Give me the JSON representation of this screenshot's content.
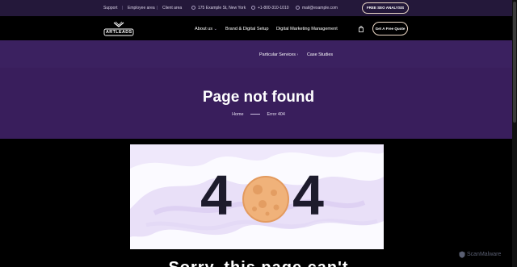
{
  "topbar": {
    "support": "Support",
    "employee": "Employee area",
    "client": "Client area",
    "address": "175 Example St, New York",
    "phone": "+1-800-310-1010",
    "email": "mail@example.com",
    "seo_button": "FREE SEO ANALYSIS"
  },
  "nav": {
    "logo_text": "ARTLEADS",
    "about": "About us",
    "brand": "Brand & Digital Setup",
    "marketing": "Digital Marketing Management",
    "quote_button": "Get A Free Quote"
  },
  "subnav": {
    "services": "Particular Services",
    "cases": "Case Studies"
  },
  "hero": {
    "title": "Page not found",
    "crumb_home": "Home",
    "crumb_current": "Error 404"
  },
  "error_image": {
    "digit_left": "4",
    "digit_right": "4"
  },
  "bottom": {
    "heading": "Sorry, this page can't"
  },
  "watermark": {
    "text": "ScanMalware"
  },
  "colors": {
    "topbar_bg": "#24183a",
    "purple": "#391e5c",
    "moon": "#f0b27a"
  }
}
